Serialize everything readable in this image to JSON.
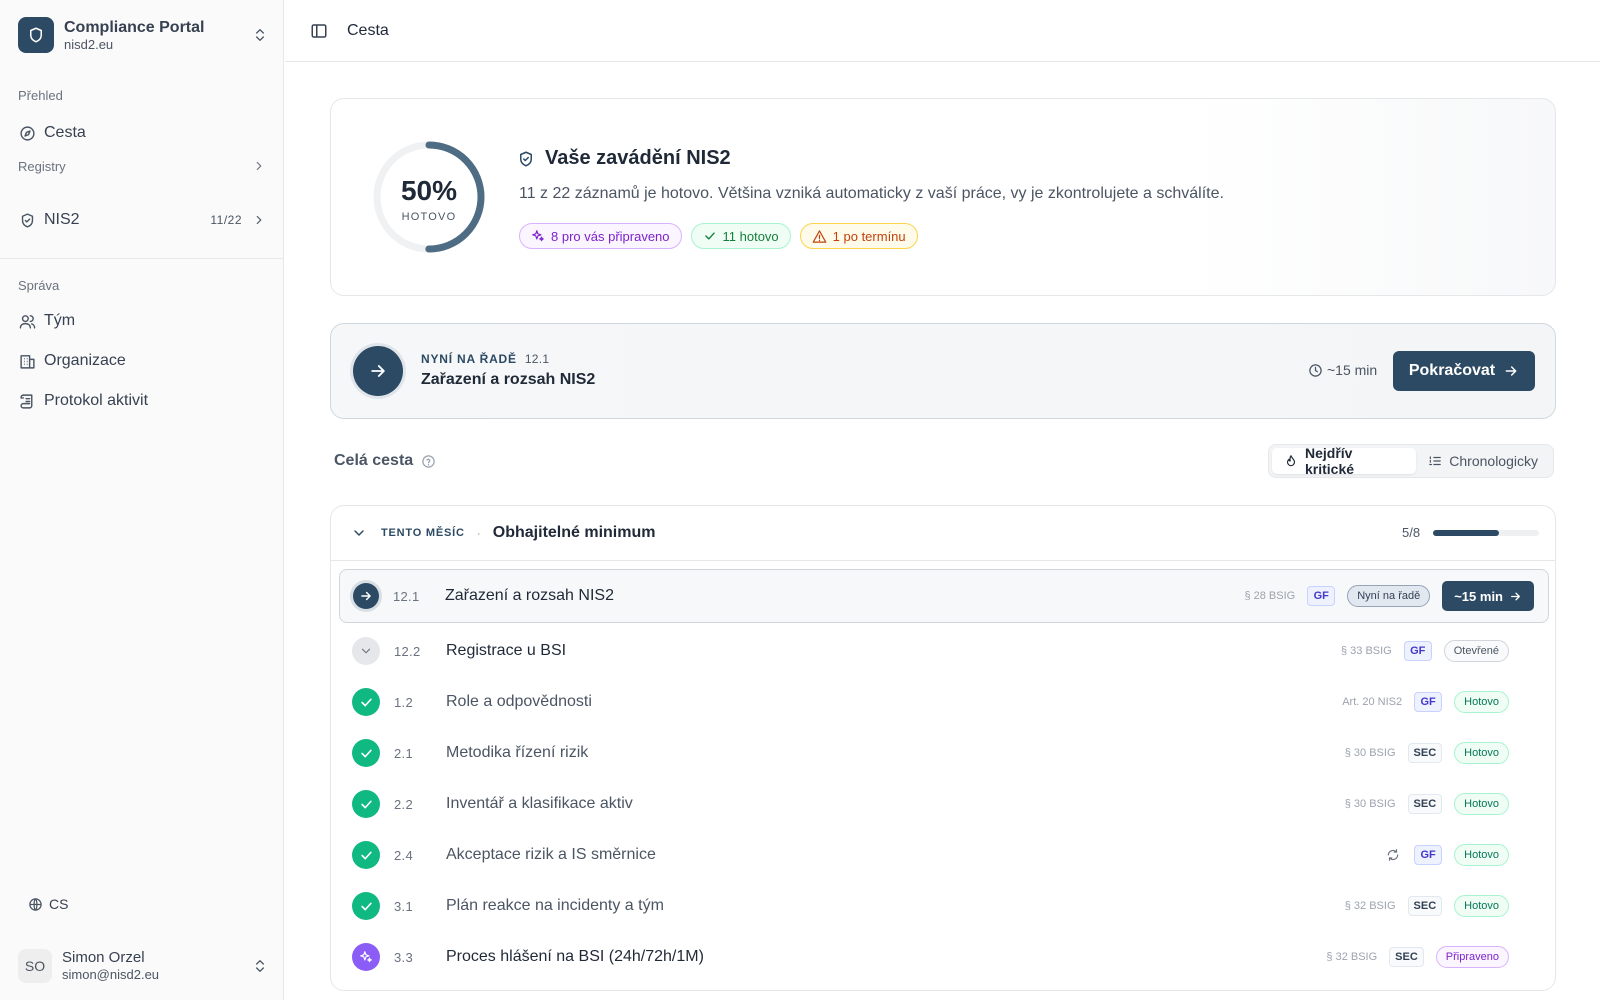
{
  "sidebar": {
    "workspace": {
      "name": "Compliance Portal",
      "domain": "nisd2.eu"
    },
    "sections": {
      "overview": "Přehled",
      "journey": "Cesta",
      "registers": "Registry",
      "nis2": {
        "label": "NIS2",
        "count": "11/22"
      },
      "admin": "Správa",
      "team": "Tým",
      "organization": "Organizace",
      "activity_log": "Protokol aktivit"
    },
    "language": "CS",
    "user": {
      "initials": "SO",
      "name": "Simon Orzel",
      "email": "simon@nisd2.eu"
    }
  },
  "topbar": {
    "breadcrumb": "Cesta"
  },
  "hero": {
    "percent": "50%",
    "percent_value": 0.5,
    "percent_label": "HOTOVO",
    "title": "Vaše zavádění NIS2",
    "description": "11 z 22 záznamů je hotovo. Většina vzniká automaticky z vaší práce, vy je zkontrolujete a schválíte.",
    "pills": {
      "prepared": "8 pro vás připraveno",
      "done": "11 hotovo",
      "overdue": "1 po termínu"
    }
  },
  "next": {
    "eyebrow": "NYNÍ NA ŘADĚ",
    "code": "12.1",
    "title": "Zařazení a rozsah NIS2",
    "time": "~15 min",
    "button": "Pokračovat"
  },
  "path": {
    "label": "Celá cesta",
    "sort": {
      "critical": "Nejdřív kritické",
      "chronological": "Chronologicky"
    }
  },
  "group": {
    "eyebrow": "TENTO MĚSÍC",
    "title": "Obhajitelné minimum",
    "count": "5/8",
    "progress": 0.625,
    "rows": [
      {
        "code": "12.1",
        "title": "Zařazení a rozsah NIS2",
        "ref": "§ 28 BSIG",
        "tag": "GF",
        "status": "Nyní na řadě",
        "button": "~15 min"
      },
      {
        "code": "12.2",
        "title": "Registrace u BSI",
        "ref": "§ 33 BSIG",
        "tag": "GF",
        "status": "Otevřené"
      },
      {
        "code": "1.2",
        "title": "Role a odpovědnosti",
        "ref": "Art. 20 NIS2",
        "tag": "GF",
        "status": "Hotovo"
      },
      {
        "code": "2.1",
        "title": "Metodika řízení rizik",
        "ref": "§ 30 BSIG",
        "tag": "SEC",
        "status": "Hotovo"
      },
      {
        "code": "2.2",
        "title": "Inventář a klasifikace aktiv",
        "ref": "§ 30 BSIG",
        "tag": "SEC",
        "status": "Hotovo"
      },
      {
        "code": "2.4",
        "title": "Akceptace rizik a IS směrnice",
        "tag": "GF",
        "status": "Hotovo"
      },
      {
        "code": "3.1",
        "title": "Plán reakce na incidenty a tým",
        "ref": "§ 32 BSIG",
        "tag": "SEC",
        "status": "Hotovo"
      },
      {
        "code": "3.3",
        "title": "Proces hlášení na BSI (24h/72h/1M)",
        "ref": "§ 32 BSIG",
        "tag": "SEC",
        "status": "Připraveno"
      }
    ]
  }
}
